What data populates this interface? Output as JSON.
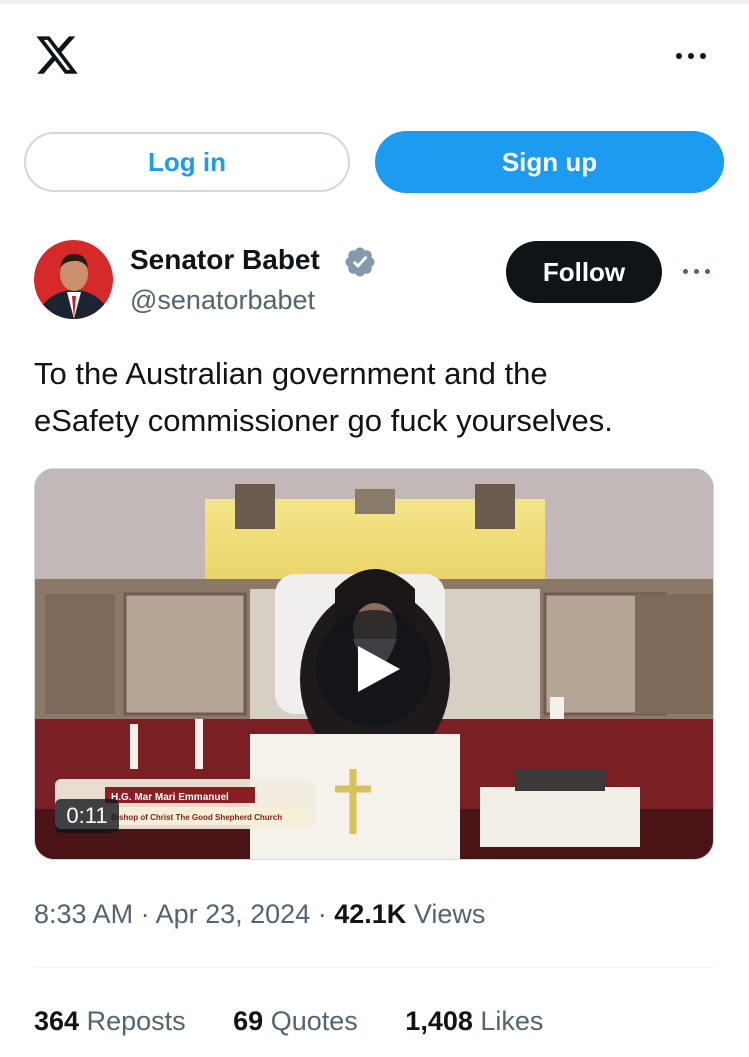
{
  "header": {
    "logo_icon": "x-logo-icon",
    "more_icon": "more-horizontal-icon"
  },
  "auth": {
    "login_label": "Log in",
    "signup_label": "Sign up"
  },
  "tweet": {
    "author_name": "Senator Babet",
    "verified_icon": "verified-badge-icon",
    "handle": "@senatorbabet",
    "follow_label": "Follow",
    "more_icon": "more-horizontal-icon",
    "text_lines": [
      "To the Australian government and the",
      "eSafety commissioner go fuck yourselves."
    ],
    "video": {
      "duration": "0:11",
      "lower_third_title": "H.G. Mar Mari Emmanuel",
      "lower_third_subtitle": "Bishop of Christ The Good Shepherd Church",
      "play_icon": "play-icon"
    },
    "time": "8:33 AM",
    "date": "Apr 23, 2024",
    "views_count": "42.1K",
    "views_label": "Views",
    "separator": "·",
    "stats": [
      {
        "count": "364",
        "label": "Reposts"
      },
      {
        "count": "69",
        "label": "Quotes"
      },
      {
        "count": "1,408",
        "label": "Likes"
      }
    ]
  },
  "colors": {
    "brand_blue": "#1d9bf0",
    "text_primary": "#0f1419",
    "text_secondary": "#536471",
    "border": "#cfd9de"
  }
}
